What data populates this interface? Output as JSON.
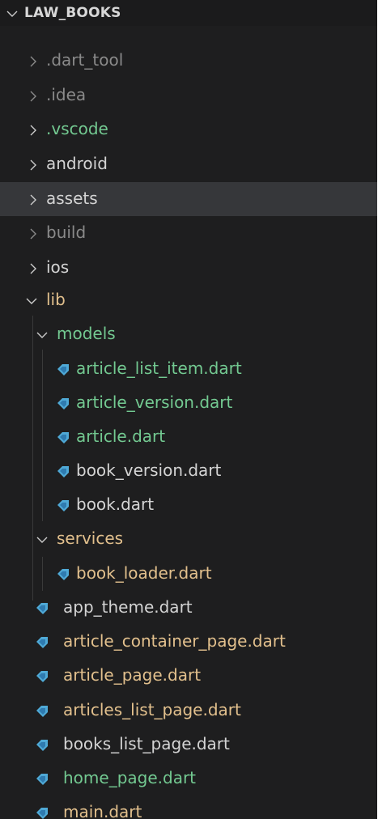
{
  "colors": {
    "background": "#1e1e1f",
    "selected_row": "#36373a",
    "dimmed": "#8a8a8a",
    "default": "#d4d4d4",
    "git_added": "#73c991",
    "git_modified": "#e2c08d",
    "dart_icon": "#4fa9d6"
  },
  "explorer": {
    "root": {
      "label": "LAW_BOOKS",
      "expanded": true
    },
    "items": [
      {
        "label": ".dart_tool",
        "type": "folder",
        "expanded": false
      },
      {
        "label": ".idea",
        "type": "folder",
        "expanded": false
      },
      {
        "label": ".vscode",
        "type": "folder",
        "expanded": false
      },
      {
        "label": "android",
        "type": "folder",
        "expanded": false
      },
      {
        "label": "assets",
        "type": "folder",
        "expanded": false,
        "selected": true
      },
      {
        "label": "build",
        "type": "folder",
        "expanded": false
      },
      {
        "label": "ios",
        "type": "folder",
        "expanded": false
      },
      {
        "label": "lib",
        "type": "folder",
        "expanded": true
      },
      {
        "label": "models",
        "type": "folder",
        "expanded": true
      },
      {
        "label": "article_list_item.dart",
        "type": "file",
        "icon": "dart-file-icon"
      },
      {
        "label": "article_version.dart",
        "type": "file",
        "icon": "dart-file-icon"
      },
      {
        "label": "article.dart",
        "type": "file",
        "icon": "dart-file-icon"
      },
      {
        "label": "book_version.dart",
        "type": "file",
        "icon": "dart-file-icon"
      },
      {
        "label": "book.dart",
        "type": "file",
        "icon": "dart-file-icon"
      },
      {
        "label": "services",
        "type": "folder",
        "expanded": true
      },
      {
        "label": "book_loader.dart",
        "type": "file",
        "icon": "dart-file-icon"
      },
      {
        "label": "app_theme.dart",
        "type": "file",
        "icon": "dart-file-icon"
      },
      {
        "label": "article_container_page.dart",
        "type": "file",
        "icon": "dart-file-icon"
      },
      {
        "label": "article_page.dart",
        "type": "file",
        "icon": "dart-file-icon"
      },
      {
        "label": "articles_list_page.dart",
        "type": "file",
        "icon": "dart-file-icon"
      },
      {
        "label": "books_list_page.dart",
        "type": "file",
        "icon": "dart-file-icon"
      },
      {
        "label": "home_page.dart",
        "type": "file",
        "icon": "dart-file-icon"
      },
      {
        "label": "main.dart",
        "type": "file",
        "icon": "dart-file-icon"
      }
    ]
  }
}
